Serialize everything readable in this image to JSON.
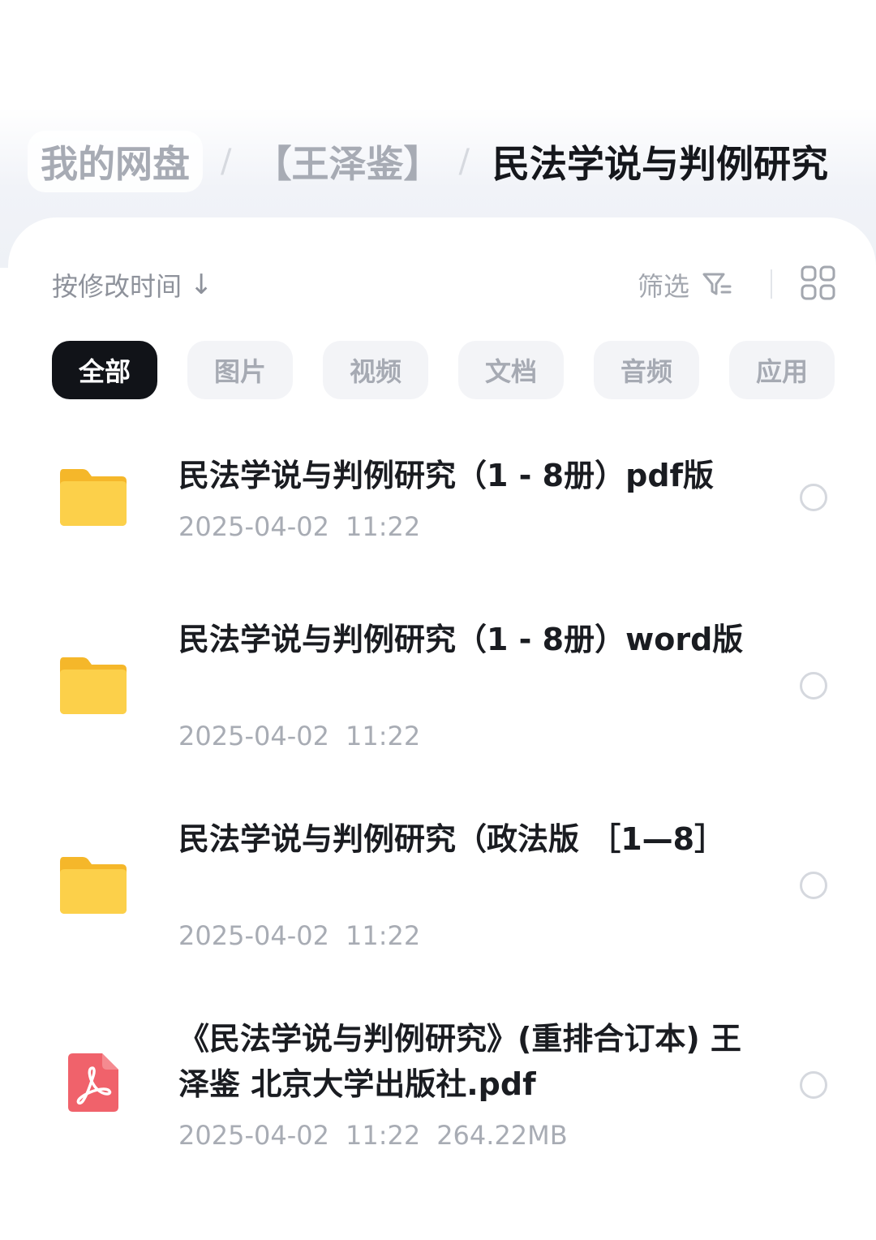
{
  "breadcrumb": {
    "home": "我的网盘",
    "middle": "【王泽鉴】",
    "current": "民法学说与判例研究",
    "separator": "/"
  },
  "toolbar": {
    "sort_label": "按修改时间",
    "sort_arrow": "↓",
    "filter_label": "筛选",
    "filter_icon": "filter-icon",
    "view_icon": "grid-view-icon"
  },
  "tabs": [
    {
      "label": "全部",
      "active": true
    },
    {
      "label": "图片",
      "active": false
    },
    {
      "label": "视频",
      "active": false
    },
    {
      "label": "文档",
      "active": false
    },
    {
      "label": "音频",
      "active": false
    },
    {
      "label": "应用",
      "active": false
    }
  ],
  "files": [
    {
      "name": "民法学说与判例研究（1 - 8册）pdf版",
      "date": "2025-04-02",
      "time": "11:22",
      "size": "",
      "icon": "folder-icon"
    },
    {
      "name": "民法学说与判例研究（1 - 8册）word版",
      "date": "2025-04-02",
      "time": "11:22",
      "size": "",
      "icon": "folder-icon"
    },
    {
      "name": "民法学说与判例研究（政法版 ［1—8］",
      "date": "2025-04-02",
      "time": "11:22",
      "size": "",
      "icon": "folder-icon"
    },
    {
      "name": "《民法学说与判例研究》(重排合订本) 王泽鉴 北京大学出版社.pdf",
      "date": "2025-04-02",
      "time": "11:22",
      "size": "264.22MB",
      "icon": "pdf-file-icon"
    }
  ],
  "colors": {
    "folder": "#fbcb3c",
    "pdf": "#f0626b",
    "active_tab": "#111318"
  }
}
